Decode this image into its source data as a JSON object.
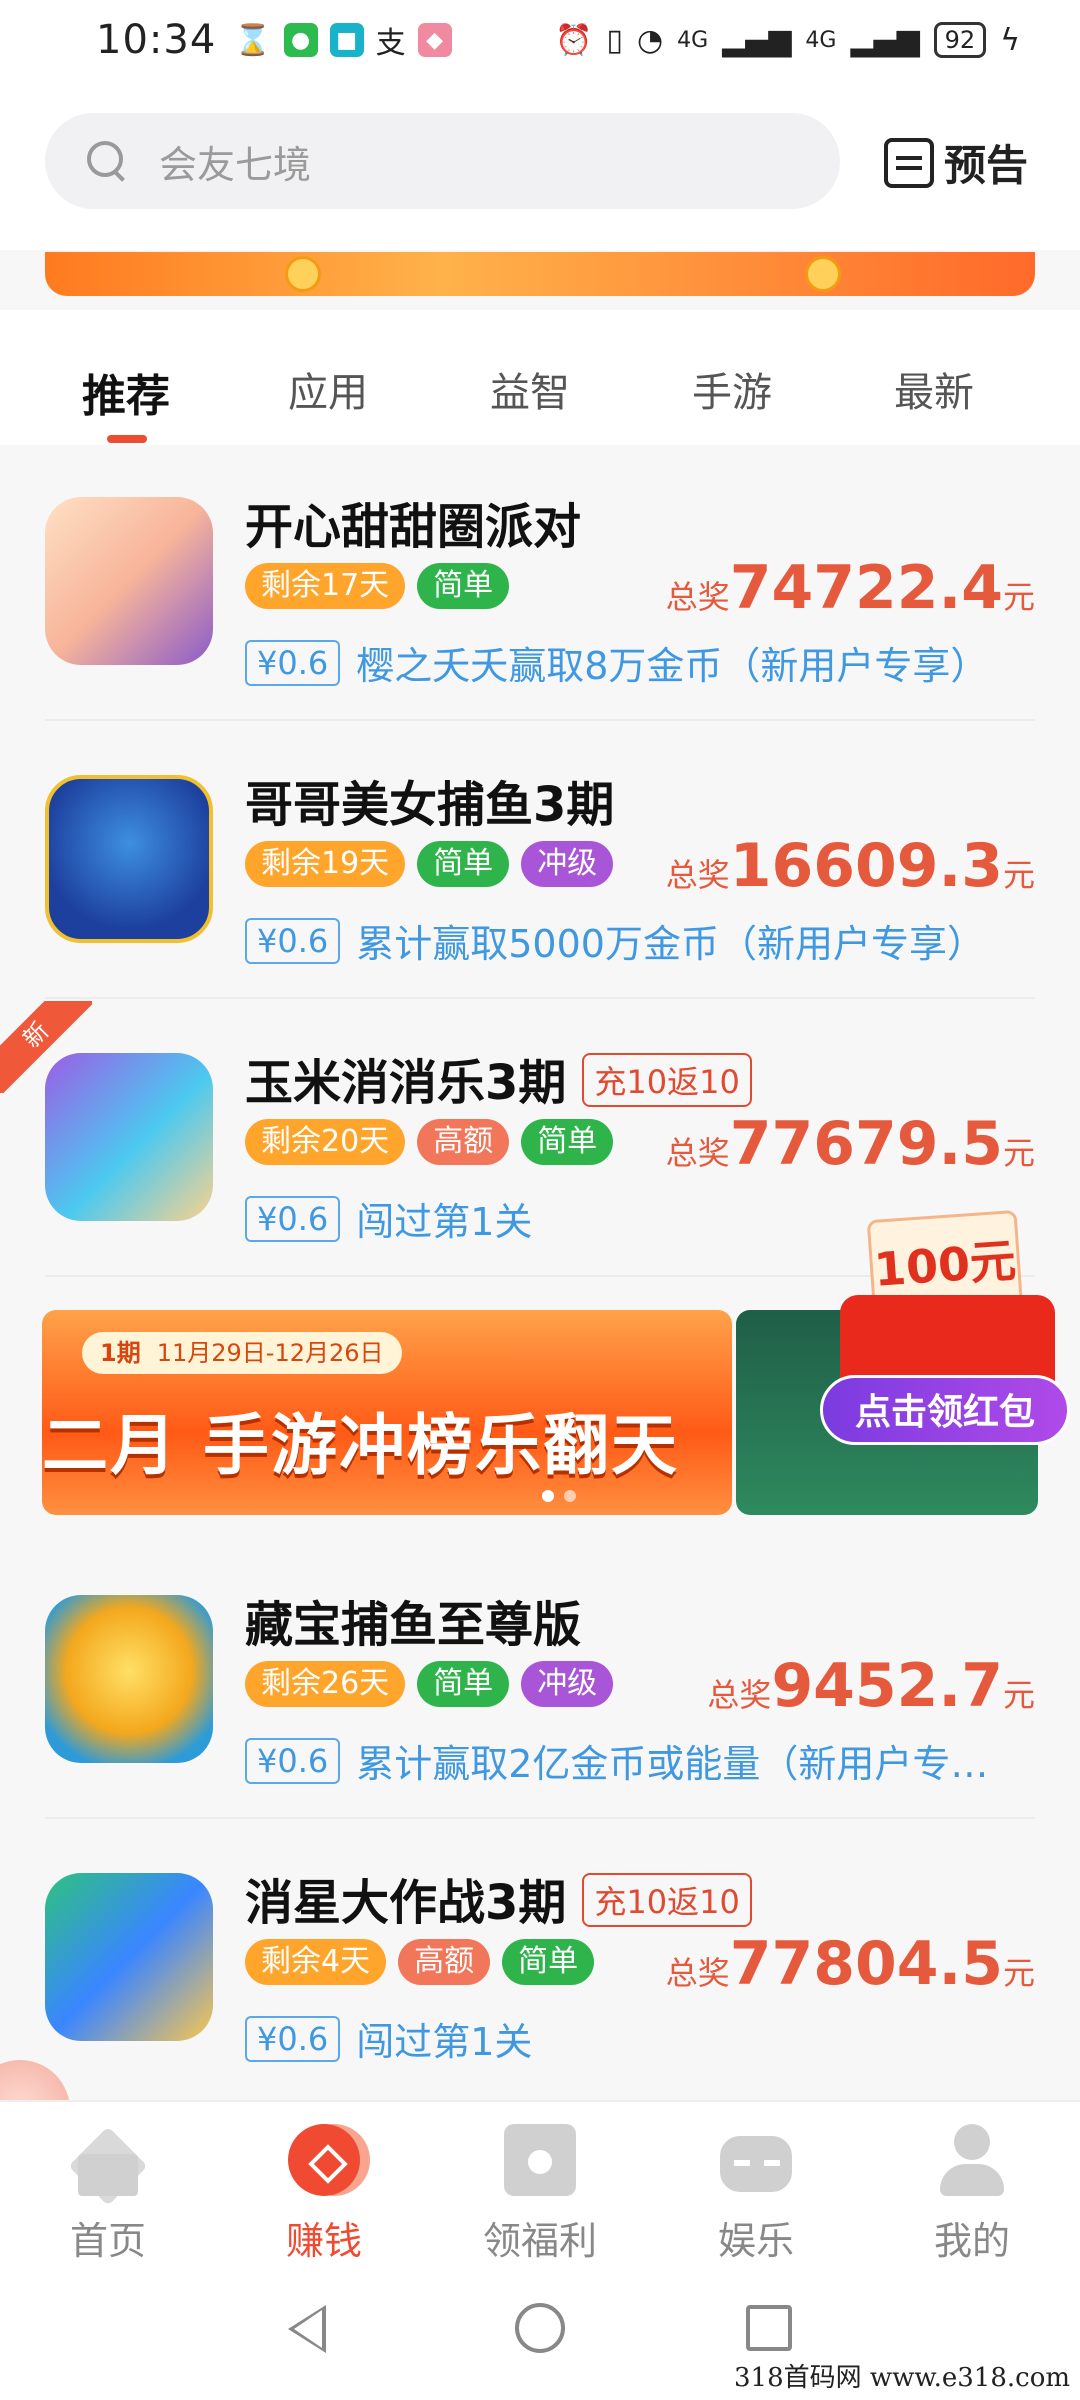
{
  "status_bar": {
    "time": "10:34",
    "battery": "92",
    "network": "4G"
  },
  "search": {
    "placeholder": "会友七境"
  },
  "header": {
    "preview_label": "预告"
  },
  "tabs": [
    "推荐",
    "应用",
    "益智",
    "手游",
    "最新"
  ],
  "games": [
    {
      "title": "开心甜甜圈派对",
      "tags": [
        {
          "text": "剩余17天",
          "color": "orange"
        },
        {
          "text": "简单",
          "color": "green"
        }
      ],
      "prize_label": "总奖",
      "prize_value": "74722.4",
      "prize_unit": "元",
      "reward_amount": "¥0.6",
      "reward_desc": "樱之夭夭赢取8万金币（新用户专享）"
    },
    {
      "title": "哥哥美女捕鱼3期",
      "tags": [
        {
          "text": "剩余19天",
          "color": "orange"
        },
        {
          "text": "简单",
          "color": "green"
        },
        {
          "text": "冲级",
          "color": "purple"
        }
      ],
      "prize_label": "总奖",
      "prize_value": "16609.3",
      "prize_unit": "元",
      "reward_amount": "¥0.6",
      "reward_desc": "累计赢取5000万金币（新用户专享）"
    },
    {
      "title": "玉米消消乐3期",
      "promo": "充10返10",
      "is_new": true,
      "new_label": "新",
      "tags": [
        {
          "text": "剩余20天",
          "color": "orange"
        },
        {
          "text": "高额",
          "color": "red"
        },
        {
          "text": "简单",
          "color": "green"
        }
      ],
      "prize_label": "总奖",
      "prize_value": "77679.5",
      "prize_unit": "元",
      "reward_amount": "¥0.6",
      "reward_desc": "闯过第1关"
    },
    {
      "title": "藏宝捕鱼至尊版",
      "tags": [
        {
          "text": "剩余26天",
          "color": "orange"
        },
        {
          "text": "简单",
          "color": "green"
        },
        {
          "text": "冲级",
          "color": "purple"
        }
      ],
      "prize_label": "总奖",
      "prize_value": "9452.7",
      "prize_unit": "元",
      "reward_amount": "¥0.6",
      "reward_desc": "累计赢取2亿金币或能量（新用户专…"
    },
    {
      "title": "消星大作战3期",
      "promo": "充10返10",
      "tags": [
        {
          "text": "剩余4天",
          "color": "orange"
        },
        {
          "text": "高额",
          "color": "red"
        },
        {
          "text": "简单",
          "color": "green"
        }
      ],
      "prize_label": "总奖",
      "prize_value": "77804.5",
      "prize_unit": "元",
      "reward_amount": "¥0.6",
      "reward_desc": "闯过第1关"
    }
  ],
  "banner": {
    "period": "1期",
    "dates": "11月29日-12月26日",
    "headline": "二月 手游冲榜乐翻天"
  },
  "red_packet": {
    "amount": "100元",
    "button": "点击领红包"
  },
  "bottom_nav": [
    "首页",
    "赚钱",
    "领福利",
    "娱乐",
    "我的"
  ],
  "watermark": "318首码网 www.e318.com"
}
